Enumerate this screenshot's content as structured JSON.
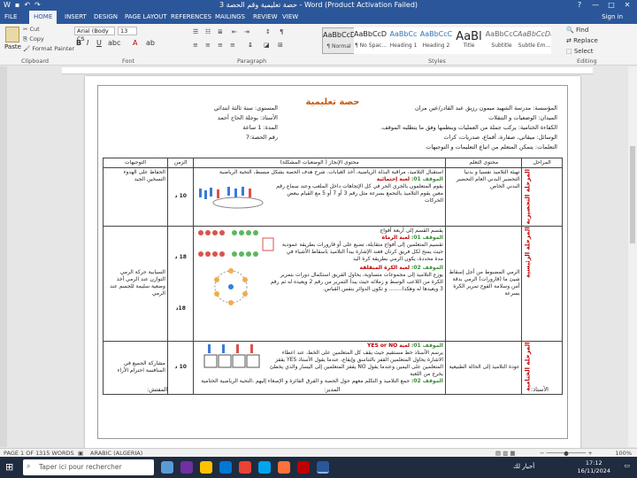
{
  "window": {
    "title": "حصة تعليمية وقم الحصة 3 - Word (Product Activation Failed)",
    "controls": [
      "?",
      "—",
      "□",
      "✕"
    ]
  },
  "ribbon_tabs": [
    "FILE",
    "HOME",
    "INSERT",
    "DESIGN",
    "PAGE LAYOUT",
    "REFERENCES",
    "MAILINGS",
    "REVIEW",
    "VIEW"
  ],
  "signin": "Sign in",
  "clipboard": {
    "paste": "Paste",
    "cut": "Cut",
    "copy": "Copy",
    "format_painter": "Format Painter",
    "label": "Clipboard"
  },
  "font": {
    "name": "Arial (Body CS",
    "size": "13",
    "label": "Font"
  },
  "paragraph": {
    "label": "Paragraph"
  },
  "styles": {
    "label": "Styles",
    "items": [
      {
        "sample": "AaBbCcDc",
        "name": "¶ Normal"
      },
      {
        "sample": "AaBbCcDc",
        "name": "¶ No Spac..."
      },
      {
        "sample": "AaBbCc",
        "name": "Heading 1"
      },
      {
        "sample": "AaBbCcC",
        "name": "Heading 2"
      },
      {
        "sample": "AaBl",
        "name": "Title"
      },
      {
        "sample": "AaBbCcC",
        "name": "Subtitle"
      },
      {
        "sample": "AaBbCcDa",
        "name": "Subtle Em..."
      }
    ]
  },
  "editing": {
    "find": "Find",
    "replace": "Replace",
    "select": "Select",
    "label": "Editing"
  },
  "document": {
    "title": "حصة تعليمية",
    "header_right": [
      "المؤسسة: مدرسة الشهيد ميمون رزيق عبد القادر/عين مران",
      "الميدان: الوضعيات و التنقلات",
      "الكفاءة الختامية: يركب جملة من العمليات وينظمها وفق ما يتطلبه الموقف.",
      "الوسائل: ميقاتي، صفارة، أقماع، صدريات، كرات",
      "التعلمات: يتمكن المتعلم من اتباع التعليمات و التوجيهات"
    ],
    "header_left": [
      "المستوى: سنة ثالثة ابتدائي",
      "الأستاذ: بوجلة الحاج أحمد",
      "المدة: 1 ساعة",
      "رقم الحصة:7"
    ],
    "table_headers": [
      "المراحل",
      "محتوى التعلم",
      "محتوى الإنجاز ( الوضعيات المشكلة)",
      "الزمن",
      "التوجيهات"
    ],
    "rows": [
      {
        "stage": "المرحلة التحضيرية",
        "objective": "تهيئة التلاميذ نفسيا و بدنيا التحضير البدني العام التحضير البدني الخاص",
        "content_intro": "استقبال التلاميذ، مراقبة البذلة الرياضية، أخذ الغيابات. شرح هدف الحصة بشكل مبسط، التحية الرياضية",
        "situation_label": "الموقف 01:",
        "situation_name": "لعبة إحتمائية",
        "content_body": "يقوم المتعلمون بالجري الحر في كل الإتجاهات داخل الملعب وعند سماع رقم معين يقوم التلاميذ بالتجمع بسرعة مثل رقم 3 أو 7 أو 5 مع القيام ببعض الحركات",
        "time": "10 د",
        "guidance": "الحفاظ على الهدوء التسخين الجيد"
      },
      {
        "stage": "المرحلة الرئيسية",
        "objective": "الرمي المضبوط من أجل إسقاط شيئ ما (قارورات) الرمي بدقة أمن وسلامة الفوج تمرير الكرة بسرعة",
        "content_intro": "يقسم القسم إلى أربعة أفواج",
        "situation_label": "الموقف 01:",
        "situation_name": "لعبة الرماة",
        "content_body": "تقسيم المتعلمين إلى أفواج متقابلة، تضبع على أو قارورات بطريقة عمودية حيث يمنح لكل فريق كرتان فعند الإشارة يبدأ التلاميذ باسقاط الأشياء في مدة محددة، يكون الرمي بطريقة كرة اليد",
        "situation2_label": "الموقف 02:",
        "situation2_name": "لعبة الكرة المبقلقة",
        "content_body2": "يوزع التلاميذ إلى مجموعات متساوية، يحاول الفريق استكمال دورات بتمرير الكرة من اللاعب الوسط و زملائه حيث يبدأ التمرير من رقم 2 ويعيده له ثم رقم 3 ويعيدها له وهكذا........ و تكون الدوائر بنفس القياس.",
        "time": "18 د",
        "time2": "18د",
        "guidance": "السيابية حركة الرمي التوازن عند الرمي أخذ وضعية سليمة للجسم عند الرمي"
      },
      {
        "stage": "المرحلة الختامية",
        "objective": "عودة التلاميذ إلى الحالة الطبيعية",
        "situation_label": "الموقف 01:",
        "situation_name": "لعبة YES or NO",
        "content_body": "يرسم الأستاذ خط مستقيم حيث يقف كل المتعلمين على الخط، عند اعطاء الاشارة يحاول المتعلمين القفز بالتناسق وإيقاع، عندما يقول الأستاذ YES يقفز المتعلمين على اليمين وعندما يقول NO يقفز المتعلمين إلى اليسار والذي يخطئ يخرج من اللعبة",
        "situation2_label": "الموقف 02:",
        "content_body2": "جمع التلاميذ و التكلم معهم حول الحصة و الفرق الفائزة و الإصغاء إليهم ،التحية الرياضية الختامية",
        "time": "10 د",
        "guidance": "مشاركة الجميع في المنافسة احترام الأراء"
      }
    ],
    "signatures": {
      "teacher": "الأستاذ:",
      "director": "المدير:",
      "inspector": "المفتش:"
    }
  },
  "status": {
    "page": "PAGE 1 OF 1",
    "words": "315 WORDS",
    "lang": "ARABIC (ALGERIA)",
    "zoom": "100%"
  },
  "taskbar": {
    "search_placeholder": "Taper ici pour rechercher",
    "weather": "أحبار لك",
    "time": "17:12",
    "date": "16/11/2024"
  }
}
